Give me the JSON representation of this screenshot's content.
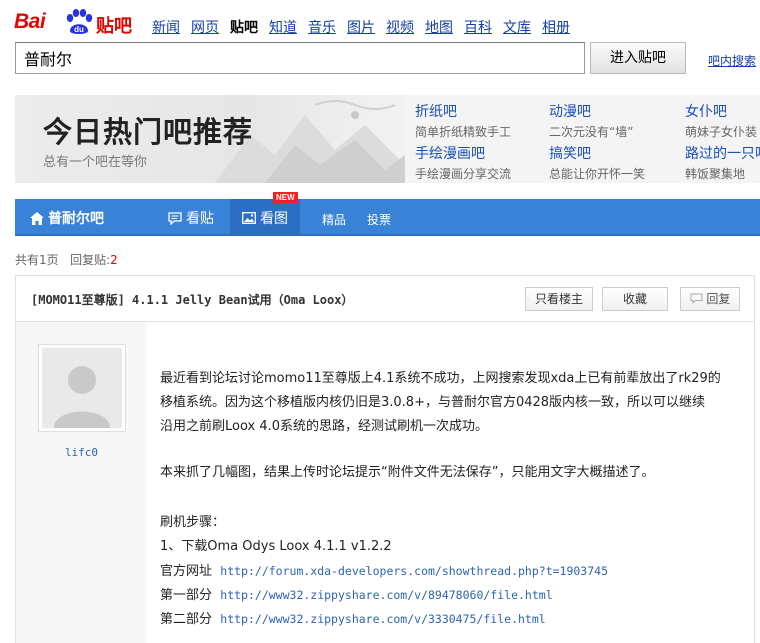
{
  "logo": {
    "text_bai": "Bai",
    "text_du": "du",
    "text_tieba": "贴吧"
  },
  "nav": [
    "新闻",
    "网页",
    "贴吧",
    "知道",
    "音乐",
    "图片",
    "视频",
    "地图",
    "百科",
    "文库",
    "相册"
  ],
  "search": {
    "value": "普耐尔",
    "button": "进入贴吧",
    "inbar": "吧内搜索"
  },
  "banner": {
    "title": "今日热门吧推荐",
    "subtitle": "总有一个吧在等你",
    "hot": [
      {
        "name": "折纸吧",
        "desc": "简单折纸精致手工"
      },
      {
        "name": "动漫吧",
        "desc": "二次元没有“墙”"
      },
      {
        "name": "女仆吧",
        "desc": "萌妹子女仆装"
      },
      {
        "name": "手绘漫画吧",
        "desc": "手绘漫画分享交流"
      },
      {
        "name": "搞笑吧",
        "desc": "总能让你开怀一笑"
      },
      {
        "name": "路过的一只吧",
        "desc": "韩饭聚集地"
      }
    ]
  },
  "forum": {
    "home": "普耐尔吧",
    "tabs": [
      "看贴",
      "看图",
      "精品",
      "投票"
    ],
    "new_badge": "NEW"
  },
  "stats": {
    "pages_label": "共有",
    "pages_value": "1",
    "pages_unit": "页",
    "replies_label": "回复贴:",
    "replies_value": "2"
  },
  "post": {
    "title": "[MOMO11至尊版] 4.1.1 Jelly Bean试用（Oma Loox）",
    "buttons": {
      "lz_only": "只看楼主",
      "collect": "收藏",
      "reply": "回复"
    },
    "author": "lifc0",
    "p1": "最近看到论坛讨论momo11至尊版上4.1系统不成功，上网搜索发现xda上已有前辈放出了rk29的移植系统。因为这个移植版内核仍旧是3.0.8+，与普耐尔官方0428版内核一致，所以可以继续沿用之前刷Loox 4.0系统的思路，经测试刷机一次成功。",
    "p1_lines": [
      "最近看到论坛讨论momo11至尊版上4.1系统不成功，上网搜索发现xda上已有前辈放出了rk29的",
      "移植系统。因为这个移植版内核仍旧是3.0.8+，与普耐尔官方0428版内核一致，所以可以继续",
      "沿用之前刷Loox 4.0系统的思路，经测试刷机一次成功。"
    ],
    "p2": "本来抓了几幅图，结果上传时论坛提示“附件文件无法保存”，只能用文字大概描述了。",
    "steps_title": "刷机步骤：",
    "step1": "1、下载Oma Odys Loox 4.1.1 v1.2.2",
    "links": [
      {
        "label": "官方网址",
        "url": "http://forum.xda-developers.com/showthread.php?t=1903745"
      },
      {
        "label": "第一部分",
        "url": "http://www32.zippyshare.com/v/89478060/file.html"
      },
      {
        "label": "第二部分",
        "url": "http://www32.zippyshare.com/v/3330475/file.html"
      }
    ]
  },
  "colors": {
    "brand_red": "#e10602",
    "tab_blue": "#3883d8",
    "link_blue": "#2d64b3"
  }
}
